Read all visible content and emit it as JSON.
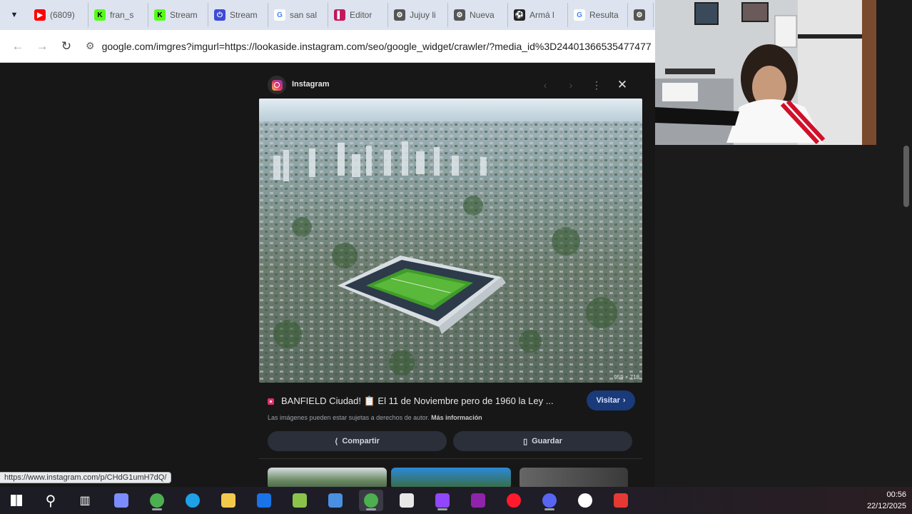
{
  "browser": {
    "tab_menu_icon": "chevron-down-icon",
    "tabs": [
      {
        "label": "(6809)",
        "icon": "youtube-icon",
        "color": "#ff0000",
        "glyph": "▶"
      },
      {
        "label": "fran_s",
        "icon": "kick-icon",
        "color": "#53fc18",
        "glyph": "K"
      },
      {
        "label": "Stream",
        "icon": "kick-icon",
        "color": "#53fc18",
        "glyph": "K"
      },
      {
        "label": "Stream",
        "icon": "streamlabs-icon",
        "color": "#3d4bd6",
        "glyph": "⏻"
      },
      {
        "label": "san sal",
        "icon": "google-icon",
        "color": "#4285f4",
        "glyph": "G"
      },
      {
        "label": "Editor",
        "icon": "editor-icon",
        "color": "#c2185b",
        "glyph": "▌"
      },
      {
        "label": "Jujuy li",
        "icon": "sport-icon",
        "color": "#555555",
        "glyph": "⚙"
      },
      {
        "label": "Nueva",
        "icon": "sport-icon",
        "color": "#555555",
        "glyph": "⚙"
      },
      {
        "label": "Armá l",
        "icon": "soccer-ball-icon",
        "color": "#222222",
        "glyph": "⚽"
      },
      {
        "label": "Resulta",
        "icon": "google-icon",
        "color": "#4285f4",
        "glyph": "G"
      },
      {
        "label": "",
        "icon": "sport-icon",
        "color": "#555555",
        "glyph": "⚙"
      }
    ],
    "url": "google.com/imgres?imgurl=https://lookaside.instagram.com/seo/google_widget/crawler/?media_id%3D24401366535477477"
  },
  "viewer": {
    "source_name": "Instagram",
    "image_size_label": "959 × 718",
    "result_title": "BANFIELD Ciudad! 📋 El 11 de Noviembre pero de 1960 la Ley ...",
    "visit_label": "Visitar",
    "copyright_text": "Las imágenes pueden estar sujetas a derechos de autor.",
    "more_info_label": "Más información",
    "share_label": "Compartir",
    "save_label": "Guardar"
  },
  "status_url": "https://www.instagram.com/p/CHdG1umH7dQ/",
  "taskbar": {
    "apps": [
      {
        "name": "windows-start-icon",
        "color": "#ffffff"
      },
      {
        "name": "search-icon",
        "color": "#ffffff"
      },
      {
        "name": "task-view-icon",
        "color": "#ffffff"
      },
      {
        "name": "copilot-icon",
        "color": "#7b8cff"
      },
      {
        "name": "chrome-icon",
        "color": "#4caf50"
      },
      {
        "name": "edge-icon",
        "color": "#1ea1e8"
      },
      {
        "name": "file-explorer-icon",
        "color": "#f2c94c"
      },
      {
        "name": "outlook-icon",
        "color": "#1a73e8"
      },
      {
        "name": "copilot-app-icon",
        "color": "#8bc34a"
      },
      {
        "name": "feather-app-icon",
        "color": "#4a90e2"
      },
      {
        "name": "chrome-profile-icon",
        "color": "#4caf50"
      },
      {
        "name": "calculator-icon",
        "color": "#e8e8e8"
      },
      {
        "name": "twitch-icon",
        "color": "#9146ff"
      },
      {
        "name": "winrar-icon",
        "color": "#8e24aa"
      },
      {
        "name": "opera-icon",
        "color": "#ff1b2d"
      },
      {
        "name": "discord-icon",
        "color": "#5865f2"
      },
      {
        "name": "obs-icon",
        "color": "#ffffff"
      },
      {
        "name": "app-icon",
        "color": "#e53935"
      }
    ],
    "time": "00:56",
    "date": "22/12/2025"
  }
}
